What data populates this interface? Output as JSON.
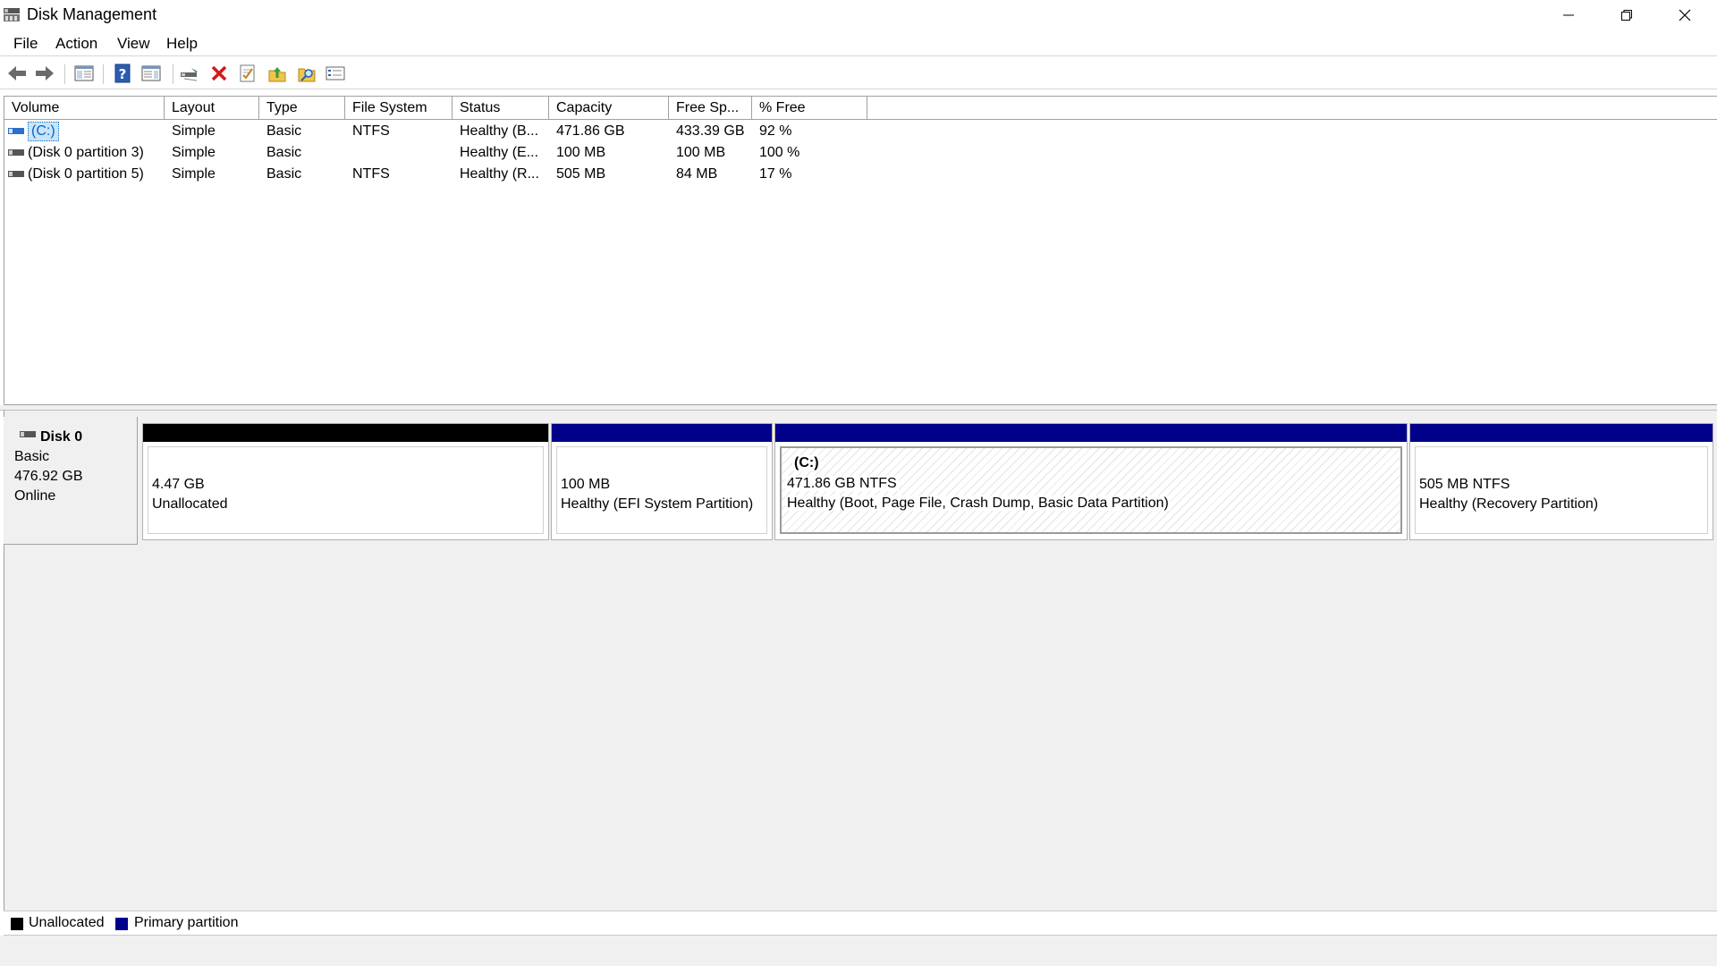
{
  "window": {
    "title": "Disk Management"
  },
  "menu": {
    "items": [
      "File",
      "Action",
      "View",
      "Help"
    ]
  },
  "toolbar": {
    "icons": [
      "back-arrow-icon",
      "forward-arrow-icon",
      "console-tree-icon",
      "help-icon",
      "show-hide-pane-icon",
      "connect-disk-icon",
      "delete-icon",
      "check-properties-icon",
      "export-up-icon",
      "search-folder-icon",
      "settings-list-icon"
    ]
  },
  "volumes": {
    "columns": [
      "Volume",
      "Layout",
      "Type",
      "File System",
      "Status",
      "Capacity",
      "Free Sp...",
      "% Free"
    ],
    "rows": [
      {
        "volume": "(C:)",
        "layout": "Simple",
        "type": "Basic",
        "fs": "NTFS",
        "status": "Healthy (B...",
        "capacity": "471.86 GB",
        "free": "433.39 GB",
        "pct": "92 %",
        "selected": true
      },
      {
        "volume": "(Disk 0 partition 3)",
        "layout": "Simple",
        "type": "Basic",
        "fs": "",
        "status": "Healthy (E...",
        "capacity": "100 MB",
        "free": "100 MB",
        "pct": "100 %"
      },
      {
        "volume": "(Disk 0 partition 5)",
        "layout": "Simple",
        "type": "Basic",
        "fs": "NTFS",
        "status": "Healthy (R...",
        "capacity": "505 MB",
        "free": "84 MB",
        "pct": "17 %"
      }
    ]
  },
  "disk": {
    "name": "Disk 0",
    "type": "Basic",
    "size": "476.92 GB",
    "state": "Online",
    "partitions": [
      {
        "label": "",
        "size": "4.47 GB",
        "desc": "Unallocated",
        "bar_color": "#000000"
      },
      {
        "label": "",
        "size": "100 MB",
        "desc": "Healthy (EFI System Partition)",
        "bar_color": "#00008b"
      },
      {
        "label": "(C:)",
        "size": "471.86 GB NTFS",
        "desc": "Healthy (Boot, Page File, Crash Dump, Basic Data Partition)",
        "bar_color": "#00008b"
      },
      {
        "label": "",
        "size": "505 MB NTFS",
        "desc": "Healthy (Recovery Partition)",
        "bar_color": "#00008b"
      }
    ]
  },
  "legend": {
    "items": [
      {
        "label": "Unallocated",
        "color": "#000000"
      },
      {
        "label": "Primary partition",
        "color": "#00008b"
      }
    ]
  }
}
